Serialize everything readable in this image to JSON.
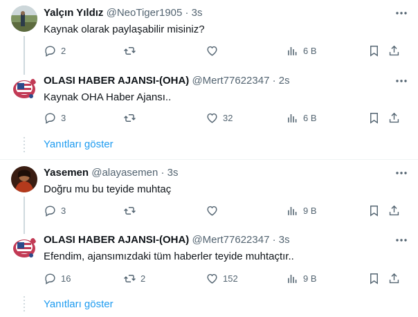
{
  "tweets": [
    {
      "name": "Yalçın Yıldız",
      "handle": "@NeoTiger1905 · 3s",
      "text": "Kaynak olarak paylaşabilir misiniz?",
      "replies": "2",
      "retweets": "",
      "likes": "",
      "views": "6 B",
      "avatar": "landscape"
    },
    {
      "name": "OLASI HABER AJANSI-(OHA)",
      "handle": "@Mert77622347 · 2s",
      "text": "Kaynak OHA Haber Ajansı..",
      "replies": "3",
      "retweets": "",
      "likes": "32",
      "views": "6 B",
      "avatar": "flag-blob"
    },
    {
      "name": "Yasemen",
      "handle": "@alayasemen · 3s",
      "text": "Doğru mu bu teyide muhtaç",
      "replies": "3",
      "retweets": "",
      "likes": "",
      "views": "9 B",
      "avatar": "portrait"
    },
    {
      "name": "OLASI HABER AJANSI-(OHA)",
      "handle": "@Mert77622347 · 3s",
      "text": "Efendim, ajansımızdaki tüm haberler teyide muhtaçtır..",
      "replies": "16",
      "retweets": "2",
      "likes": "152",
      "views": "9 B",
      "avatar": "flag-blob"
    }
  ],
  "show_replies_label": "Yanıtları göster",
  "colors": {
    "accent": "#1d9bf0",
    "muted": "#536471",
    "line": "#cfd9de"
  }
}
